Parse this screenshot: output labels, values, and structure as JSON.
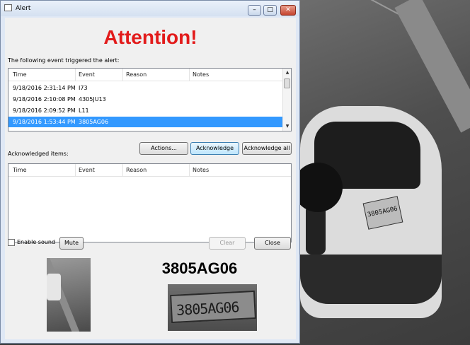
{
  "window": {
    "title": "Alert",
    "min_glyph": "–",
    "max_glyph": "□",
    "close_glyph": "✕"
  },
  "heading": "Attention!",
  "events_label": "The following event triggered the alert:",
  "columns": [
    "Time",
    "Event",
    "Reason",
    "Notes"
  ],
  "events": [
    {
      "time": "9/18/2016 2:31:14 PM",
      "event": "I73"
    },
    {
      "time": "9/18/2016 2:10:08 PM",
      "event": "4305JU13"
    },
    {
      "time": "9/18/2016 2:09:52 PM",
      "event": "L11"
    },
    {
      "time": "9/18/2016 1:53:44 PM",
      "event": "3805AG06",
      "selected": true
    }
  ],
  "buttons": {
    "actions": "Actions...",
    "acknowledge": "Acknowledge",
    "acknowledge_all": "Acknowledge all",
    "mute": "Mute",
    "clear": "Clear",
    "close": "Close"
  },
  "acknowledged_label": "Acknowledged items:",
  "enable_sound": {
    "label": "Enable sound",
    "checked": false
  },
  "plate_number": "3805AG06",
  "scrollbar": {
    "up": "▲",
    "down": "▼"
  },
  "colors": {
    "heading": "#e21b1b",
    "selection": "#3399ff"
  }
}
